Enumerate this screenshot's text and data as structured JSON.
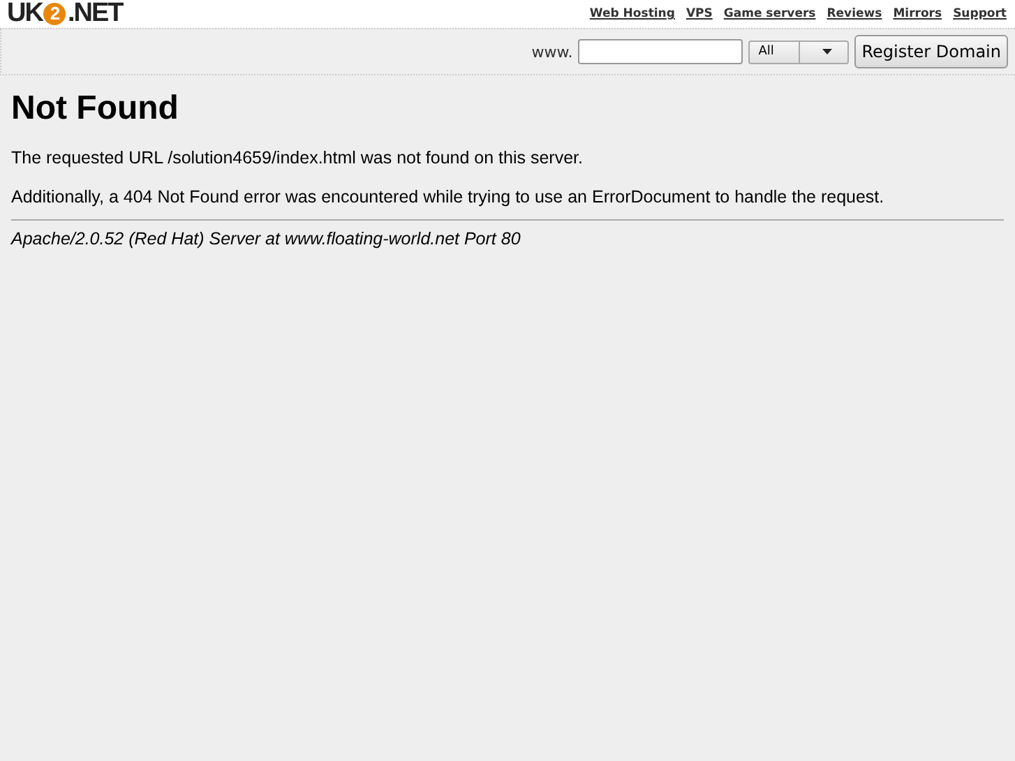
{
  "logo": {
    "prefix": "UK",
    "mark": "2",
    "suffix": ".NET"
  },
  "top_links": [
    "Web Hosting",
    "VPS",
    "Game servers",
    "Reviews",
    "Mirrors",
    "Support"
  ],
  "domain_search": {
    "prefix": "www.",
    "select": "All",
    "button": "Register Domain"
  },
  "heading": "Not Found",
  "paragraphs": [
    "The requested URL /solution4659/index.html was not found on this server.",
    "Additionally, a 404 Not Found error was encountered while trying to use an ErrorDocument to handle the request."
  ],
  "address": "Apache/2.0.52 (Red Hat) Server at www.floating-world.net Port 80"
}
